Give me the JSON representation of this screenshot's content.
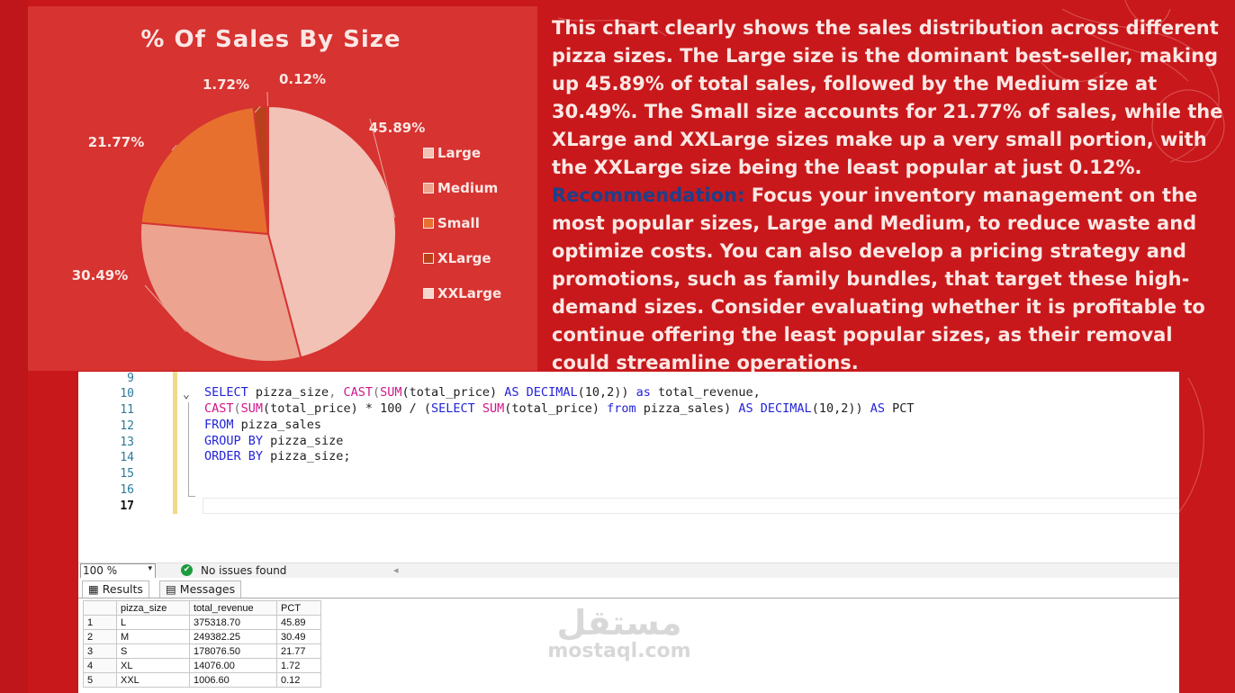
{
  "chart_data": {
    "type": "pie",
    "title": "% Of Sales By Size",
    "categories": [
      "Large",
      "Medium",
      "Small",
      "XLarge",
      "XXLarge"
    ],
    "values": [
      45.89,
      30.49,
      21.77,
      1.72,
      0.12
    ],
    "labels": [
      "45.89%",
      "30.49%",
      "21.77%",
      "1.72%",
      "0.12%"
    ],
    "colors": [
      "#f2c2b6",
      "#eca38f",
      "#e8702f",
      "#b8401a",
      "#f6d6cc"
    ],
    "legend_position": "right"
  },
  "description": {
    "body": "This chart clearly shows the sales distribution across different pizza sizes. The Large size is the dominant best-seller, making up 45.89% of total sales, followed by the Medium size at 30.49%. The Small size accounts for 21.77% of sales, while the XLarge and XXLarge sizes make up a very small portion, with the XXLarge size being the least popular at just 0.12%.",
    "reco_label": "Recommendation:",
    "reco_text": " Focus your inventory management on the most popular sizes, Large and Medium, to reduce waste and optimize costs. You can also develop a pricing strategy and promotions, such as family bundles, that target these high-demand sizes. Consider evaluating whether it is profitable to continue offering the least popular sizes, as their removal could streamline operations."
  },
  "editor": {
    "line_numbers": [
      "9",
      "10",
      "11",
      "12",
      "13",
      "14",
      "15",
      "16",
      "17"
    ],
    "fold_marker": "⌄",
    "code": {
      "l10_a": "SELECT",
      "l10_b": " pizza_size",
      "l10_c": ", ",
      "l10_d": "CAST",
      "l10_e": "(",
      "l10_f": "SUM",
      "l10_g": "(total_price) ",
      "l10_h": "AS DECIMAL",
      "l10_i": "(10,2)) ",
      "l10_j": "as",
      "l10_k": " total_revenue,",
      "l11_a": "CAST",
      "l11_b": "(",
      "l11_c": "SUM",
      "l11_d": "(total_price) * 100 / (",
      "l11_e": "SELECT",
      "l11_f": " ",
      "l11_g": "SUM",
      "l11_h": "(total_price) ",
      "l11_i": "from",
      "l11_j": " pizza_sales) ",
      "l11_k": "AS DECIMAL",
      "l11_l": "(10,2)) ",
      "l11_m": "AS",
      "l11_n": " PCT",
      "l12_a": "FROM",
      "l12_b": " pizza_sales",
      "l13_a": "GROUP BY",
      "l13_b": " pizza_size",
      "l14_a": "ORDER BY",
      "l14_b": " pizza_size;"
    }
  },
  "status": {
    "zoom": "100 %",
    "zoom_arrow": "▾",
    "ok_glyph": "✔",
    "issues": "No issues found",
    "scroll_arrow": "◂"
  },
  "results": {
    "tabs": [
      "Results",
      "Messages"
    ],
    "columns": [
      "pizza_size",
      "total_revenue",
      "PCT"
    ],
    "rows": [
      [
        "1",
        "L",
        "375318.70",
        "45.89"
      ],
      [
        "2",
        "M",
        "249382.25",
        "30.49"
      ],
      [
        "3",
        "S",
        "178076.50",
        "21.77"
      ],
      [
        "4",
        "XL",
        "14076.00",
        "1.72"
      ],
      [
        "5",
        "XXL",
        "1006.60",
        "0.12"
      ]
    ]
  },
  "watermark": {
    "arabic": "مستقل",
    "latin": "mostaql.com"
  }
}
